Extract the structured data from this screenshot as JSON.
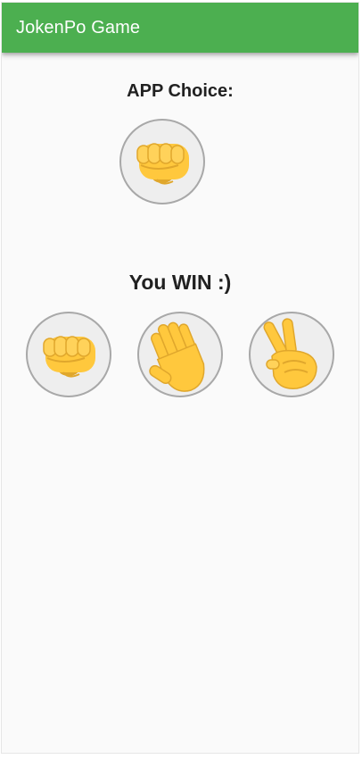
{
  "appbar": {
    "title": "JokenPo Game",
    "color": "#4caf50"
  },
  "app_choice": {
    "label": "APP Choice:",
    "icon": "fist-icon"
  },
  "result": {
    "text": "You WIN :)"
  },
  "options": [
    {
      "name": "rock",
      "icon": "fist-icon"
    },
    {
      "name": "paper",
      "icon": "open-hand-icon"
    },
    {
      "name": "scissors",
      "icon": "victory-hand-icon"
    }
  ],
  "colors": {
    "skin": "#ffc83d",
    "skin_shadow": "#e0a72c",
    "background": "#fafafa",
    "circle_fill": "#eeeeee",
    "circle_border": "#a8a8a8"
  }
}
